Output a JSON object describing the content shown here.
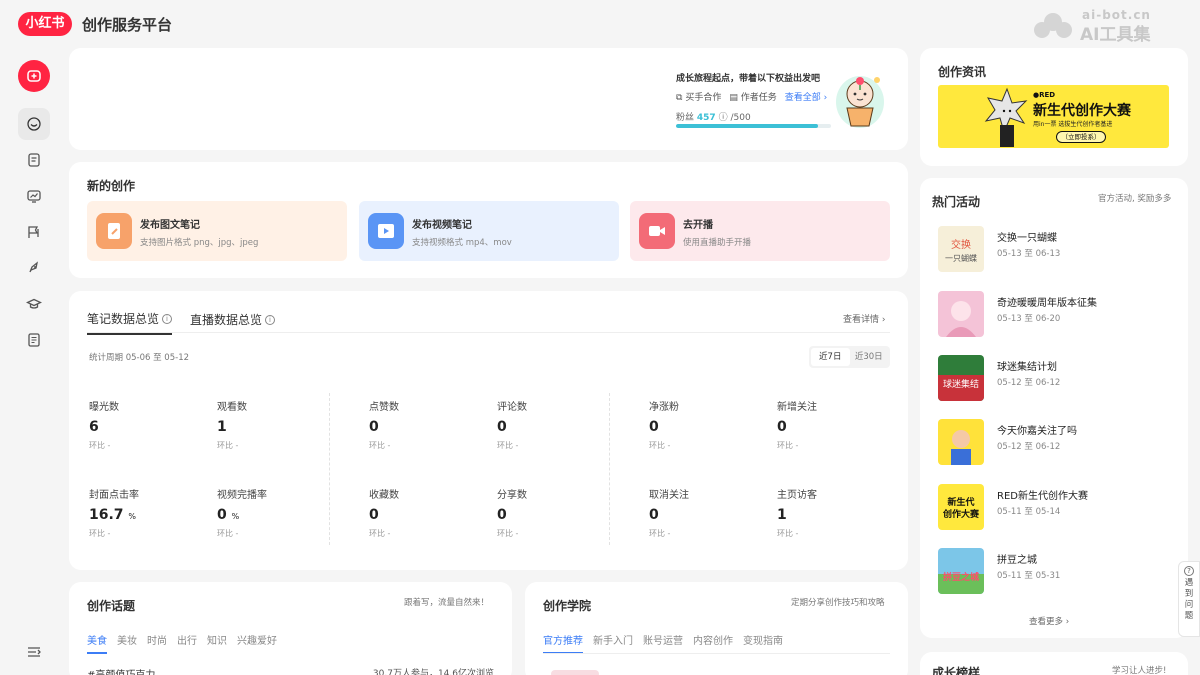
{
  "header": {
    "logo": "小红书",
    "title": "创作服务平台",
    "watermark_top": "ai-bot.cn",
    "watermark_bottom": "AI工具集"
  },
  "growth": {
    "title": "成长旅程起点，带着以下权益出发吧",
    "link_cooperation": "买手合作",
    "link_tasks": "作者任务",
    "link_view_all": "查看全部",
    "fans_label": "粉丝",
    "fans_value": "457",
    "fans_target": "/500",
    "progress": 0.914
  },
  "create": {
    "title": "新的创作",
    "tiles": [
      {
        "title": "发布图文笔记",
        "sub": "支持图片格式 png、jpg、jpeg"
      },
      {
        "title": "发布视频笔记",
        "sub": "支持视频格式 mp4、mov"
      },
      {
        "title": "去开播",
        "sub": "使用直播助手开播"
      }
    ]
  },
  "data": {
    "tab_notes": "笔记数据总览",
    "tab_live": "直播数据总览",
    "view_detail": "查看详情",
    "period": "统计周期 05-06 至 05-12",
    "range_7": "近7日",
    "range_30": "近30日",
    "compare_label": "环比 -",
    "metrics": [
      {
        "label": "曝光数",
        "value": "6",
        "unit": ""
      },
      {
        "label": "观看数",
        "value": "1",
        "unit": ""
      },
      {
        "label": "点赞数",
        "value": "0",
        "unit": ""
      },
      {
        "label": "评论数",
        "value": "0",
        "unit": ""
      },
      {
        "label": "净涨粉",
        "value": "0",
        "unit": ""
      },
      {
        "label": "新增关注",
        "value": "0",
        "unit": ""
      },
      {
        "label": "封面点击率",
        "value": "16.7",
        "unit": "%"
      },
      {
        "label": "视频完播率",
        "value": "0",
        "unit": "%"
      },
      {
        "label": "收藏数",
        "value": "0",
        "unit": ""
      },
      {
        "label": "分享数",
        "value": "0",
        "unit": ""
      },
      {
        "label": "取消关注",
        "value": "0",
        "unit": ""
      },
      {
        "label": "主页访客",
        "value": "1",
        "unit": ""
      }
    ]
  },
  "topics": {
    "title": "创作话题",
    "note": "跟着写，流量自然来！",
    "tabs": [
      "美食",
      "美妆",
      "时尚",
      "出行",
      "知识",
      "兴趣爱好"
    ],
    "first_topic": "#高颜值巧克力",
    "first_stat": "30.7万人参与，14.6亿次浏览"
  },
  "academy": {
    "title": "创作学院",
    "note": "定期分享创作技巧和攻略",
    "tabs": [
      "官方推荐",
      "新手入门",
      "账号运营",
      "内容创作",
      "变现指南"
    ]
  },
  "news": {
    "title": "创作资讯",
    "banner_brand": "●RED",
    "banner_title": "新生代创作大赛",
    "banner_sub": "用in一票 选拔生代创作者基进",
    "banner_btn": "（立即投系）"
  },
  "hot": {
    "title": "热门活动",
    "note": "官方活动, 奖励多多",
    "more": "查看更多",
    "items": [
      {
        "title": "交换一只蝴蝶",
        "date": "05-13 至 06-13"
      },
      {
        "title": "奇迹暖暖周年版本征集",
        "date": "05-13 至 06-20"
      },
      {
        "title": "球迷集结计划",
        "date": "05-12 至 06-12"
      },
      {
        "title": "今天你嘉关注了吗",
        "date": "05-12 至 06-12"
      },
      {
        "title": "RED新生代创作大赛",
        "date": "05-11 至 05-14"
      },
      {
        "title": "拼豆之城",
        "date": "05-11 至 05-31"
      }
    ]
  },
  "growth_list": {
    "title": "成长榜样",
    "note": "学习让人进步!"
  },
  "help": {
    "label": "遇到问题"
  },
  "colors": {
    "brand": "#ff2442",
    "accent_blue": "#3c7df6",
    "progress_teal": "#3cc0d6"
  }
}
